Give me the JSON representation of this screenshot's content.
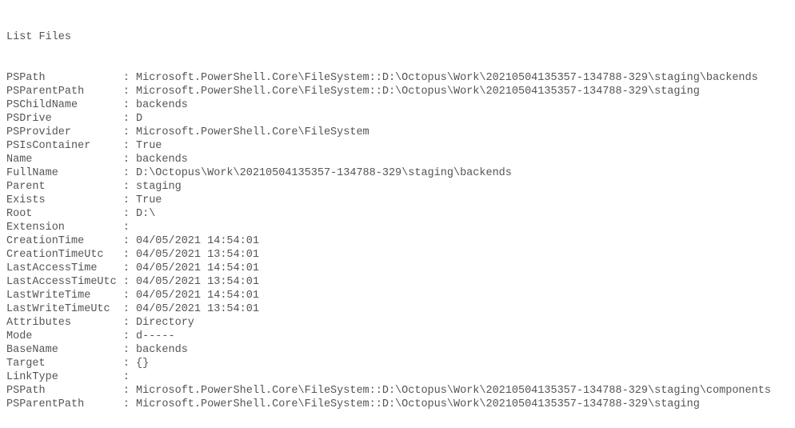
{
  "header": "List Files",
  "rows": [
    {
      "key": "PSPath",
      "sep": ": ",
      "val": "Microsoft.PowerShell.Core\\FileSystem::D:\\Octopus\\Work\\20210504135357-134788-329\\staging\\backends"
    },
    {
      "key": "PSParentPath",
      "sep": ": ",
      "val": "Microsoft.PowerShell.Core\\FileSystem::D:\\Octopus\\Work\\20210504135357-134788-329\\staging"
    },
    {
      "key": "PSChildName",
      "sep": ": ",
      "val": "backends"
    },
    {
      "key": "PSDrive",
      "sep": ": ",
      "val": "D"
    },
    {
      "key": "PSProvider",
      "sep": ": ",
      "val": "Microsoft.PowerShell.Core\\FileSystem"
    },
    {
      "key": "PSIsContainer",
      "sep": ": ",
      "val": "True"
    },
    {
      "key": "Name",
      "sep": ": ",
      "val": "backends"
    },
    {
      "key": "FullName",
      "sep": ": ",
      "val": "D:\\Octopus\\Work\\20210504135357-134788-329\\staging\\backends"
    },
    {
      "key": "Parent",
      "sep": ": ",
      "val": "staging"
    },
    {
      "key": "Exists",
      "sep": ": ",
      "val": "True"
    },
    {
      "key": "Root",
      "sep": ": ",
      "val": "D:\\"
    },
    {
      "key": "Extension",
      "sep": ": ",
      "val": ""
    },
    {
      "key": "CreationTime",
      "sep": ": ",
      "val": "04/05/2021 14:54:01"
    },
    {
      "key": "CreationTimeUtc",
      "sep": ": ",
      "val": "04/05/2021 13:54:01"
    },
    {
      "key": "LastAccessTime",
      "sep": ": ",
      "val": "04/05/2021 14:54:01"
    },
    {
      "key": "LastAccessTimeUtc",
      "sep": ": ",
      "val": "04/05/2021 13:54:01"
    },
    {
      "key": "LastWriteTime",
      "sep": ": ",
      "val": "04/05/2021 14:54:01"
    },
    {
      "key": "LastWriteTimeUtc",
      "sep": ": ",
      "val": "04/05/2021 13:54:01"
    },
    {
      "key": "Attributes",
      "sep": ": ",
      "val": "Directory"
    },
    {
      "key": "Mode",
      "sep": ": ",
      "val": "d-----"
    },
    {
      "key": "BaseName",
      "sep": ": ",
      "val": "backends"
    },
    {
      "key": "Target",
      "sep": ": ",
      "val": "{}"
    },
    {
      "key": "LinkType",
      "sep": ": ",
      "val": ""
    },
    {
      "key": "PSPath",
      "sep": ": ",
      "val": "Microsoft.PowerShell.Core\\FileSystem::D:\\Octopus\\Work\\20210504135357-134788-329\\staging\\components"
    },
    {
      "key": "PSParentPath",
      "sep": ": ",
      "val": "Microsoft.PowerShell.Core\\FileSystem::D:\\Octopus\\Work\\20210504135357-134788-329\\staging"
    }
  ]
}
